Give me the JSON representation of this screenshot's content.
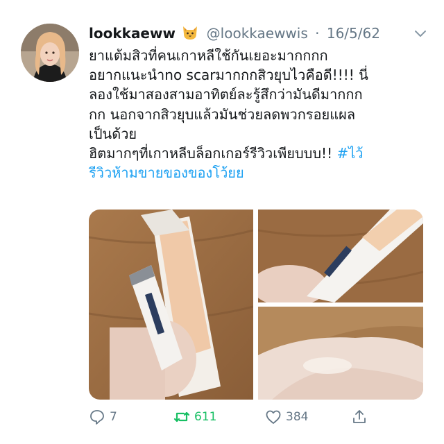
{
  "tweet": {
    "display_name": "lookkaeww",
    "name_emoji": "cat-face-icon",
    "handle": "@lookkaewwis",
    "separator": "·",
    "date": "16/5/62",
    "text_lines": [
      "ยาแต้มสิวที่คนเกาหลีใช้กันเยอะมากกกก",
      "อยากแนะนำno scarมากกกสิวยุบไวคือดี!!!! นี่",
      "ลองใช้มาสองสามอาทิตย์ละรู้สึกว่ามันดีมากกก",
      "กก นอกจากสิวยุบแล้วมันช่วยลดพวกรอยแผล",
      "เป็นด้วย",
      "ฮิตมากๆที่เกาหลีบล็อกเกอร์รีวิวเพียบบบ!! "
    ],
    "hashtag_part1": "#ไว้",
    "hashtag_part2": "รีวิวห้ามขายของของโว้ยย",
    "media": [
      {
        "name": "product-box-and-tube-photo",
        "desc_icon": "photo"
      },
      {
        "name": "tube-closeup-photo",
        "desc_icon": "photo"
      },
      {
        "name": "cream-on-hand-photo",
        "desc_icon": "photo"
      }
    ],
    "actions": {
      "reply_icon": "speech-bubble-icon",
      "reply_count": "7",
      "retweet_icon": "retweet-icon",
      "retweet_count": "611",
      "like_icon": "heart-icon",
      "like_count": "384",
      "share_icon": "share-icon"
    },
    "colors": {
      "text": "#14171a",
      "secondary": "#657786",
      "link": "#1da1f2",
      "retweet_active": "#17bf63"
    }
  }
}
